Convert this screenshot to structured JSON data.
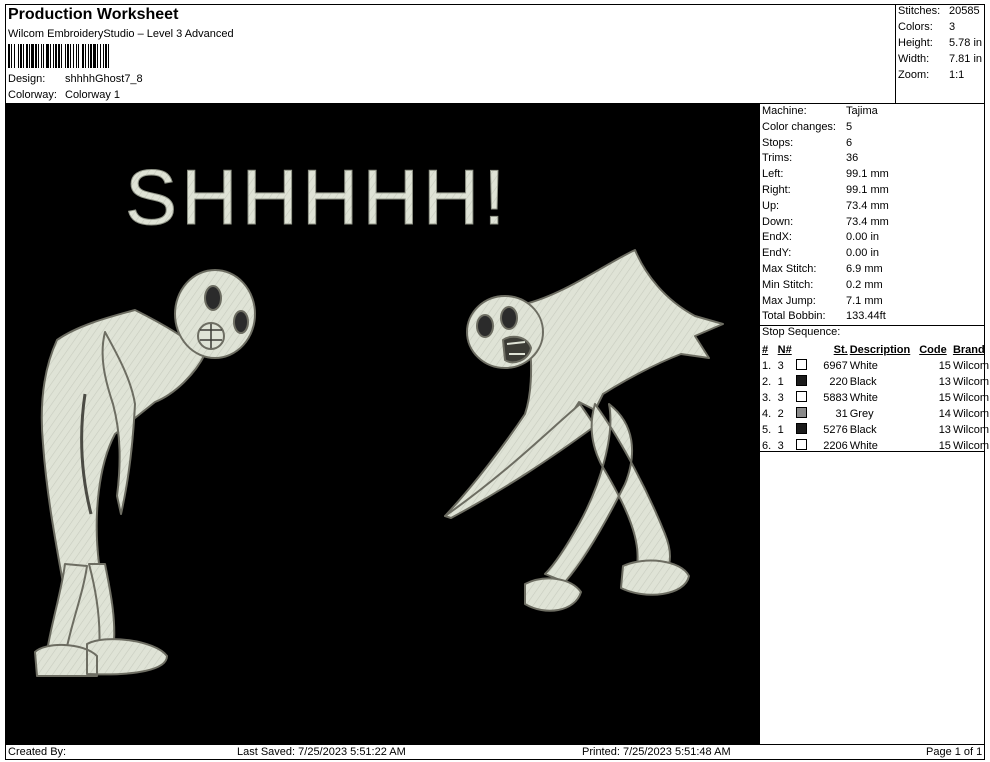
{
  "header": {
    "title": "Production Worksheet",
    "subtitle": "Wilcom EmbroideryStudio – Level 3 Advanced",
    "design_label": "Design:",
    "design_value": "shhhhGhost7_8",
    "colorway_label": "Colorway:",
    "colorway_value": "Colorway 1"
  },
  "summary": {
    "stitches_label": "Stitches:",
    "stitches": "20585",
    "colors_label": "Colors:",
    "colors": "3",
    "height_label": "Height:",
    "height": "5.78 in",
    "width_label": "Width:",
    "width": "7.81 in",
    "zoom_label": "Zoom:",
    "zoom": "1:1"
  },
  "design_preview": {
    "text": "SHHHHH!",
    "thread_color": "#dfe3d6",
    "outline_color": "#6d6d62",
    "background": "#000000"
  },
  "machine_stats": [
    {
      "label": "Machine:",
      "value": "Tajima"
    },
    {
      "label": "Color changes:",
      "value": "5"
    },
    {
      "label": "Stops:",
      "value": "6"
    },
    {
      "label": "Trims:",
      "value": "36"
    },
    {
      "label": "Left:",
      "value": "99.1 mm"
    },
    {
      "label": "Right:",
      "value": "99.1 mm"
    },
    {
      "label": "Up:",
      "value": "73.4 mm"
    },
    {
      "label": "Down:",
      "value": "73.4 mm"
    },
    {
      "label": "EndX:",
      "value": "0.00 in"
    },
    {
      "label": "EndY:",
      "value": "0.00 in"
    },
    {
      "label": "Max Stitch:",
      "value": "6.9 mm"
    },
    {
      "label": "Min Stitch:",
      "value": "0.2 mm"
    },
    {
      "label": "Max Jump:",
      "value": "7.1 mm"
    },
    {
      "label": "Total Bobbin:",
      "value": "133.44ft"
    }
  ],
  "stop_sequence": {
    "title": "Stop Sequence:",
    "columns": [
      "#",
      "N#",
      "St.",
      "Description",
      "Code",
      "Brand"
    ],
    "rows": [
      {
        "idx": "1.",
        "n": "3",
        "swatch": "#ffffff",
        "st": "6967",
        "desc": "White",
        "code": "15",
        "brand": "Wilcom"
      },
      {
        "idx": "2.",
        "n": "1",
        "swatch": "#1a1a1a",
        "st": "220",
        "desc": "Black",
        "code": "13",
        "brand": "Wilcom"
      },
      {
        "idx": "3.",
        "n": "3",
        "swatch": "#ffffff",
        "st": "5883",
        "desc": "White",
        "code": "15",
        "brand": "Wilcom"
      },
      {
        "idx": "4.",
        "n": "2",
        "swatch": "#8a8a8a",
        "st": "31",
        "desc": "Grey",
        "code": "14",
        "brand": "Wilcom"
      },
      {
        "idx": "5.",
        "n": "1",
        "swatch": "#1a1a1a",
        "st": "5276",
        "desc": "Black",
        "code": "13",
        "brand": "Wilcom"
      },
      {
        "idx": "6.",
        "n": "3",
        "swatch": "#ffffff",
        "st": "2206",
        "desc": "White",
        "code": "15",
        "brand": "Wilcom"
      }
    ]
  },
  "footer": {
    "created": "Created By:",
    "last_saved": "Last Saved: 7/25/2023 5:51:22 AM",
    "printed": "Printed: 7/25/2023 5:51:48 AM",
    "page": "Page 1 of 1"
  }
}
